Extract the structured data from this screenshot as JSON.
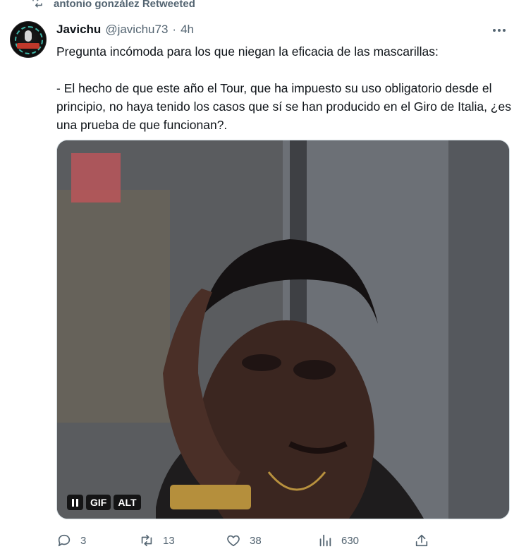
{
  "retweet": {
    "text": "antonio gonzález Retweeted",
    "icon": "retweet-icon"
  },
  "avatar": {
    "alt": "Javichu avatar",
    "badge_text": "EL RESPETO"
  },
  "author": {
    "name": "Javichu",
    "handle": "@javichu73",
    "separator": "·",
    "time": "4h"
  },
  "tweet": {
    "text": "Pregunta incómoda para los que niegan la eficacia de las mascarillas:\n\n- El hecho de que este año el Tour, que ha impuesto su uso obligatorio desde el principio, no haya tenido los casos que sí se han producido en el Giro de Italia, ¿es una prueba de que funcionan?."
  },
  "media": {
    "type": "gif",
    "gif_label": "GIF",
    "alt_label": "ALT",
    "pause_icon": "pause-icon",
    "sign_text": "!!!"
  },
  "actions": {
    "replies": "3",
    "retweets": "13",
    "likes": "38",
    "views": "630"
  },
  "colors": {
    "text_primary": "#0f1419",
    "text_secondary": "#536471",
    "border": "#cfd9de"
  }
}
